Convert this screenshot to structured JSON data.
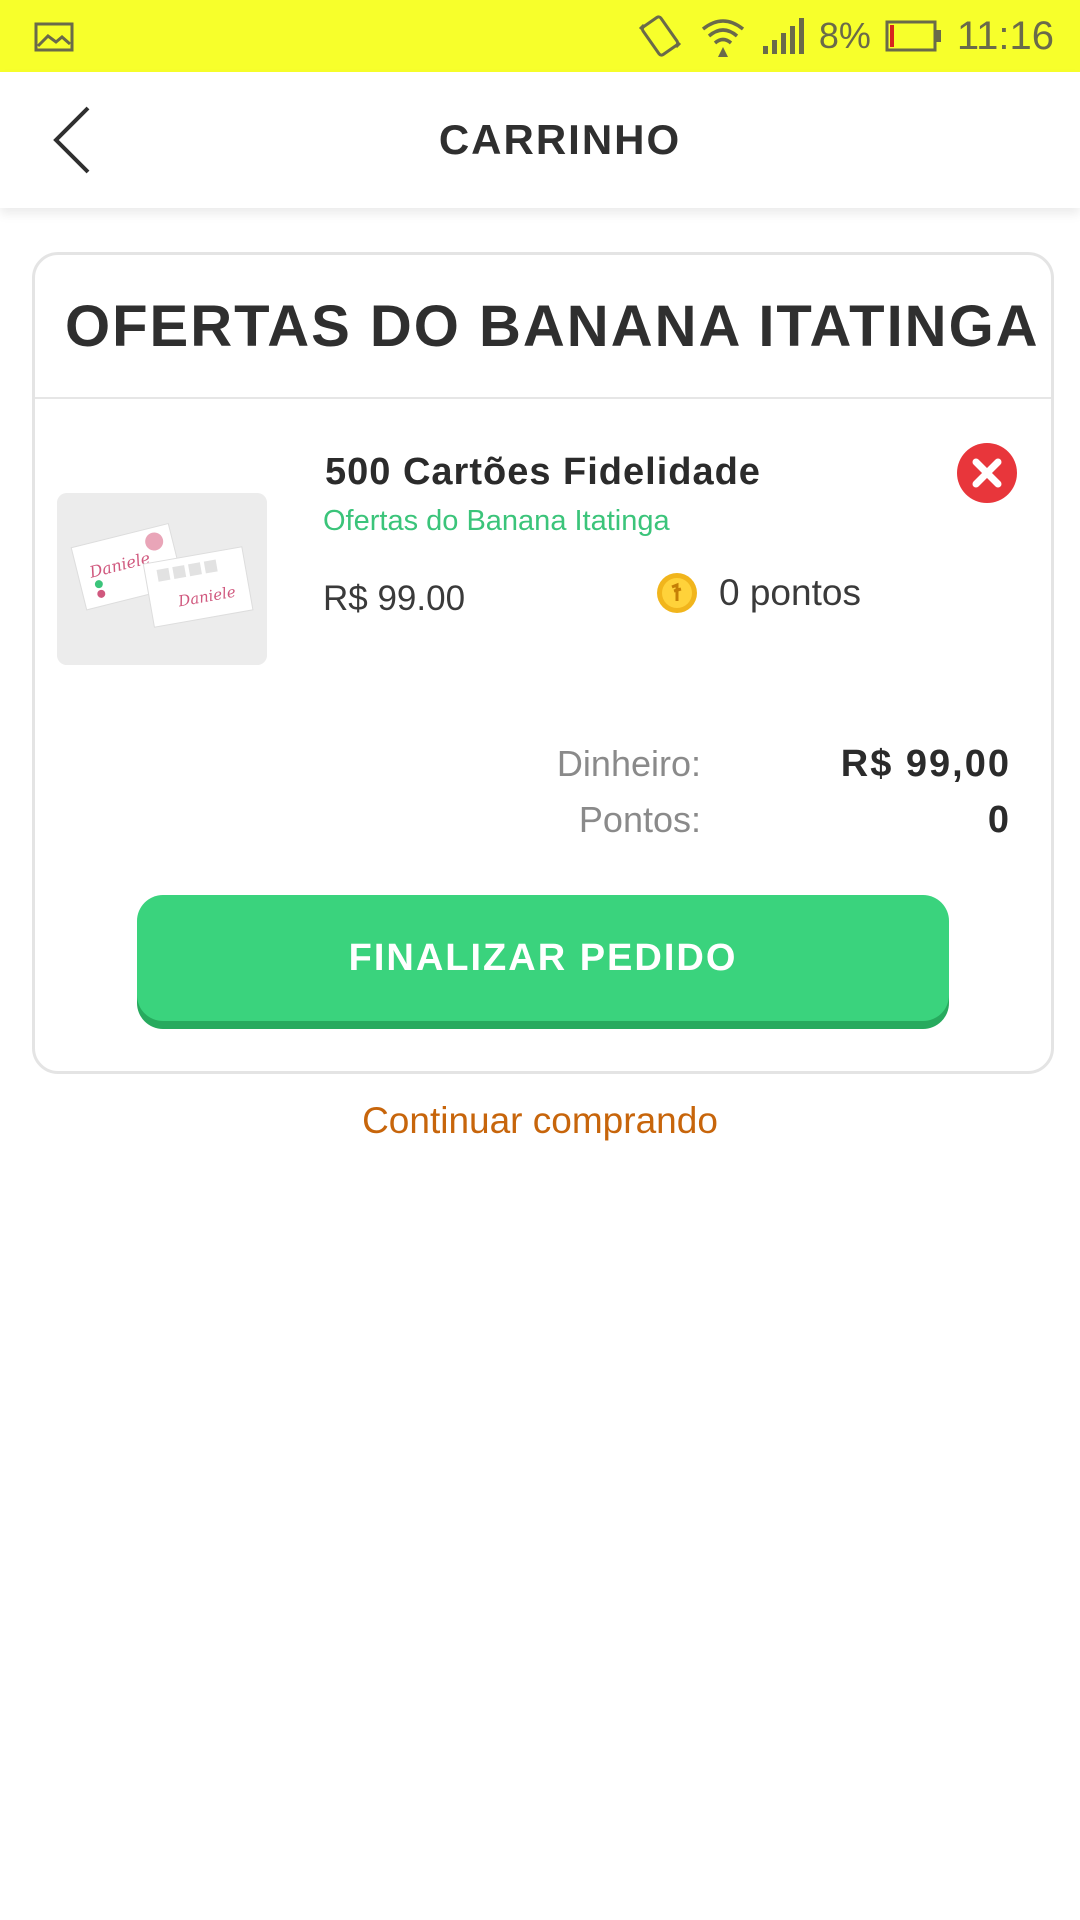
{
  "status_bar": {
    "battery_percent": "8%",
    "time": "11:16",
    "icons": [
      "image-icon",
      "vibrate-icon",
      "wifi-icon",
      "signal-icon",
      "battery-icon"
    ]
  },
  "app_bar": {
    "title": "CARRINHO",
    "back_icon": "chevron-left-icon"
  },
  "cart": {
    "store_name": "OFERTAS DO BANANA ITATINGA",
    "items": [
      {
        "name": "500 Cartões Fidelidade",
        "store": "Ofertas do Banana Itatinga",
        "price": "R$ 99.00",
        "points": "0 pontos",
        "remove_icon": "close-circle-icon",
        "points_icon": "coin-icon"
      }
    ],
    "totals": {
      "money_label": "Dinheiro:",
      "money_value": "R$ 99,00",
      "points_label": "Pontos:",
      "points_value": "0"
    },
    "finalize_label": "FINALIZAR PEDIDO"
  },
  "continue_label": "Continuar comprando",
  "colors": {
    "status_bar": "#f7ff2b",
    "accent_green": "#3ad37d",
    "store_link_green": "#3bc47a",
    "continue_orange": "#c7650b",
    "remove_red": "#e8363b"
  }
}
